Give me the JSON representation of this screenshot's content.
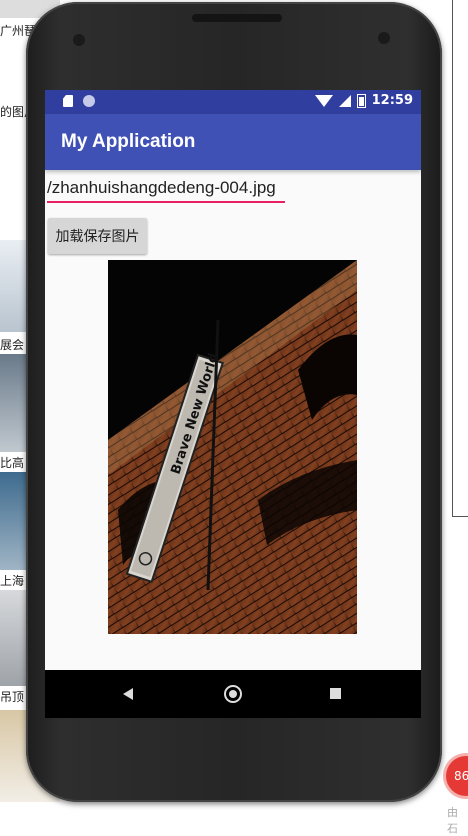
{
  "background": {
    "items": [
      {
        "label": "广州琶洲"
      },
      {
        "label": "的图片"
      },
      {
        "label": "展会"
      },
      {
        "label": "比高"
      },
      {
        "label": "上海"
      },
      {
        "label": "吊顶"
      }
    ],
    "badge_value": "86",
    "badge_caption": "由石"
  },
  "statusbar": {
    "time": "12:59",
    "icons": [
      "sd-card-icon",
      "circle-icon",
      "wifi-icon",
      "signal-icon",
      "battery-icon"
    ]
  },
  "appbar": {
    "title": "My Application"
  },
  "form": {
    "filename_value": "/zhanhuishangdedeng-004.jpg",
    "load_button": "加载保存图片"
  },
  "image": {
    "banner_text": "Brave New World"
  },
  "navbar": {
    "icons": [
      "back-icon",
      "home-icon",
      "recent-apps-icon"
    ]
  },
  "colors": {
    "status_bar": "#303f9f",
    "app_bar": "#3f51b5",
    "accent_underline": "#e91e63",
    "badge": "#e53935"
  }
}
